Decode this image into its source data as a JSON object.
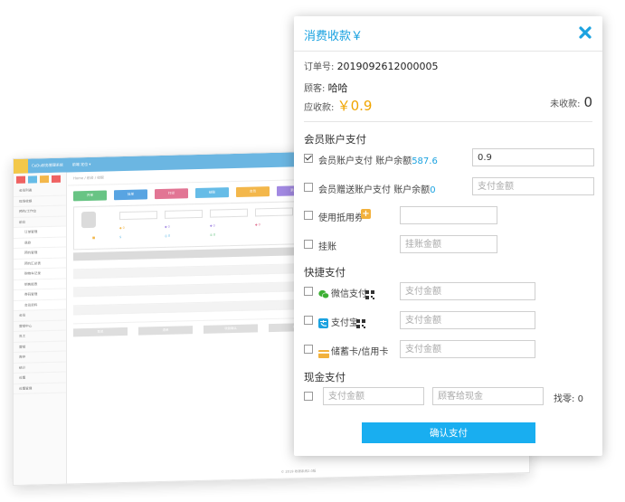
{
  "background_app": {
    "brand": "CeDu财务管理系统",
    "top_menu": "前端 定位 ▾",
    "breadcrumb": "Home / 前台 / 收银",
    "sidebar_items": [
      "会员列表",
      "现场收银",
      "预约/工作台",
      "前台",
      "订单管理",
      "退款",
      "预约管理",
      "预约汇总表",
      "购物车记录",
      "销售报表",
      "券码管理",
      "会员资料",
      "会员",
      "营销中心",
      "员工",
      "营销",
      "库存",
      "统计",
      "设置",
      "设置管理"
    ],
    "tool_buttons": [
      {
        "label": "开单",
        "color": "#5cbf7a"
      },
      {
        "label": "挂单",
        "color": "#4a9de0"
      },
      {
        "label": "打印",
        "color": "#e06a8c"
      },
      {
        "label": "结账",
        "color": "#5ab7e6"
      },
      {
        "label": "会员",
        "color": "#f2b13c"
      },
      {
        "label": "添加",
        "color": "#9b7fe0"
      }
    ],
    "table_buttons": [
      "取单",
      "退单",
      "收款确认",
      "挂单"
    ],
    "footer": "© 2019 收银系统2.0版"
  },
  "modal": {
    "title": "消费收款￥",
    "order_label": "订单号:",
    "order_no": "2019092612000005",
    "customer_label": "顾客:",
    "customer_name": "哈哈",
    "received_label": "应收款:",
    "received_amount": "￥0.9",
    "due_label": "未收款:",
    "due_amount": "0",
    "member_section": "会员账户支付",
    "member_pay": {
      "label": "会员账户支付",
      "balance_label": "账户余额",
      "balance": "587.6",
      "value": "0.9",
      "checked": true
    },
    "gift_pay": {
      "label": "会员赠送账户支付",
      "balance_label": "账户余额",
      "balance": "0",
      "placeholder": "支付金额",
      "checked": false
    },
    "coupon": {
      "label": "使用抵用券",
      "checked": false
    },
    "credit": {
      "label": "挂账",
      "placeholder": "挂账金额",
      "checked": false
    },
    "quick_section": "快捷支付",
    "wechat": {
      "label": "微信支付",
      "placeholder": "支付金额",
      "checked": false
    },
    "alipay": {
      "label": "支付宝",
      "placeholder": "支付金额",
      "checked": false
    },
    "card": {
      "label": "储蓄卡/信用卡",
      "placeholder": "支付金额",
      "checked": false
    },
    "cash_section": "现金支付",
    "cash": {
      "pay_placeholder": "支付金额",
      "given_placeholder": "顾客给现金",
      "checked": false
    },
    "change_label": "找零:",
    "change_value": "0",
    "confirm_label": "确认支付"
  },
  "colors": {
    "accent": "#1ba2e0",
    "amount": "#f0a500",
    "confirm": "#19aef0",
    "wechat": "#3cb034",
    "alipay": "#1ba2e0",
    "card": "#f2b13c",
    "coupon": "#f2b13c"
  }
}
